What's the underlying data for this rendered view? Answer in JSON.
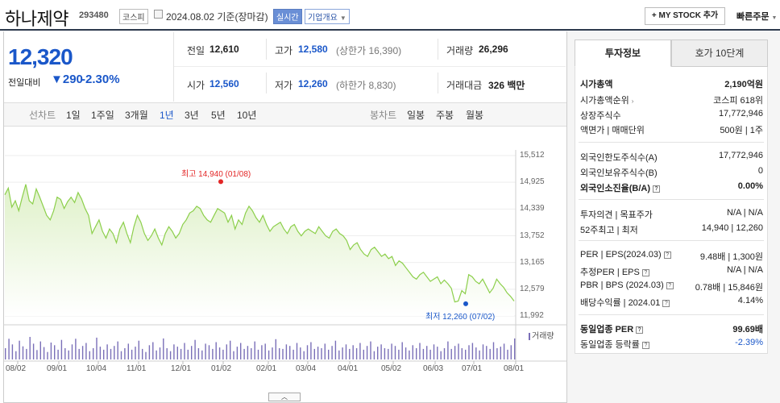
{
  "header": {
    "name": "하나제약",
    "code": "293480",
    "market": "코스피",
    "date_text": "2024.08.02 기준(장마감)",
    "realtime_tag": "실시간",
    "overview_tag": "기업개요",
    "mystock_label": "+ MY STOCK 추가",
    "quick_order": "빠른주문"
  },
  "quote": {
    "price": "12,320",
    "diff_label": "전일대비",
    "diff_arrow": "▼",
    "diff_value": "290",
    "diff_pct": "-2.30%",
    "prev_label": "전일",
    "prev_value": "12,610",
    "high_label": "고가",
    "high_value": "12,580",
    "upper_limit": "(상한가 16,390)",
    "volume_label": "거래량",
    "volume_value": "26,296",
    "open_label": "시가",
    "open_value": "12,560",
    "low_label": "저가",
    "low_value": "12,260",
    "lower_limit": "(하한가 8,830)",
    "amount_label": "거래대금",
    "amount_value": "326 백만"
  },
  "periods": {
    "line_label": "선차트",
    "line_items": [
      "1일",
      "1주일",
      "3개월",
      "1년",
      "3년",
      "5년",
      "10년"
    ],
    "selected": "1년",
    "candle_label": "봉차트",
    "candle_items": [
      "일봉",
      "주봉",
      "월봉"
    ]
  },
  "chart_data": {
    "type": "area",
    "title": "",
    "y_ticks": [
      "15,512",
      "14,925",
      "14,339",
      "13,752",
      "13,165",
      "12,579",
      "11,992"
    ],
    "ylim": [
      11992,
      15512
    ],
    "x_ticks": [
      "08/02",
      "09/01",
      "10/04",
      "11/01",
      "12/01",
      "01/02",
      "02/01",
      "03/04",
      "04/01",
      "05/02",
      "06/03",
      "07/01",
      "08/01"
    ],
    "high_label": "최고 14,940 (01/08)",
    "low_label": "최저 12,260 (07/02)",
    "high": 14940,
    "low": 12260,
    "volume_label": "거래량",
    "series": [
      {
        "values": [
          14650,
          14800,
          14380,
          14520,
          14300,
          14600,
          14880,
          14520,
          14450,
          14780,
          14600,
          14400,
          14200,
          14100,
          14300,
          14600,
          14550,
          14350,
          14500,
          14600,
          14480,
          14700,
          14560,
          14350,
          14200,
          13800,
          13950,
          14100,
          13850,
          13700,
          13900,
          13800,
          13600,
          13900,
          14050,
          13800,
          13600,
          13950,
          14200,
          14050,
          13800,
          13650,
          13750,
          13900,
          13700,
          13550,
          13800,
          13950,
          13850,
          13700,
          13800,
          14000,
          14100,
          14250,
          14300,
          14400,
          14350,
          14200,
          14100,
          14050,
          14200,
          14350,
          14300,
          14250,
          14050,
          14200,
          13900,
          14100,
          14000,
          14250,
          14400,
          14300,
          14150,
          14050,
          14200,
          14000,
          13850,
          13950,
          14000,
          14050,
          13900,
          13800,
          13950,
          14000,
          13850,
          13750,
          13850,
          13900,
          13850,
          13800,
          13950,
          13850,
          13750,
          13700,
          13850,
          13900,
          13800,
          13750,
          13650,
          13450,
          13550,
          13600,
          13450,
          13350,
          13300,
          13450,
          13500,
          13400,
          13300,
          13350,
          13250,
          13300,
          13100,
          13200,
          13150,
          13050,
          12950,
          12850,
          12800,
          12900,
          12950,
          12850,
          12750,
          12800,
          12850,
          12700,
          12780,
          12700,
          12600,
          12300,
          12320,
          12550,
          12480,
          12900,
          12850,
          12750,
          12700,
          12800,
          12650,
          12500,
          12600,
          12800,
          12700,
          12620,
          12500,
          12420,
          12320
        ]
      }
    ],
    "volume": [
      30,
      55,
      40,
      22,
      50,
      35,
      28,
      60,
      42,
      25,
      48,
      33,
      20,
      45,
      38,
      26,
      52,
      30,
      24,
      40,
      55,
      28,
      36,
      44,
      22,
      30,
      58,
      34,
      26,
      40,
      28,
      36,
      48,
      22,
      30,
      42,
      26,
      34,
      50,
      28,
      20,
      38,
      46,
      24,
      32,
      56,
      30,
      22,
      40,
      34,
      28,
      44,
      26,
      36,
      52,
      30,
      24,
      42,
      38,
      28,
      46,
      32,
      26,
      40,
      50,
      22,
      34,
      44,
      28,
      36,
      30,
      48,
      26,
      38,
      42,
      24,
      32,
      54,
      30,
      28,
      40,
      36,
      26,
      44,
      32,
      22,
      38,
      46,
      28,
      34,
      30,
      42,
      26,
      36,
      50,
      24,
      32,
      40,
      28,
      38,
      30,
      44,
      26,
      36,
      48,
      22,
      34,
      40,
      30,
      28,
      42,
      36,
      26,
      46,
      32,
      24,
      38,
      30,
      44,
      28,
      36,
      26,
      40,
      34,
      22,
      30,
      48,
      28,
      36,
      42,
      30,
      26,
      38,
      44,
      32,
      24,
      40,
      36,
      28,
      46,
      30,
      34,
      42,
      26,
      38,
      56
    ]
  },
  "right": {
    "tab_active": "투자정보",
    "tab_other": "호가 10단계",
    "rows1": [
      {
        "label": "시가총액",
        "value": "2,190억원",
        "bold": true
      },
      {
        "label": "시가총액순위",
        "value": "코스피 618위",
        "caret": true
      },
      {
        "label": "상장주식수",
        "value": "17,772,946"
      },
      {
        "label": "액면가 | 매매단위",
        "value": "500원 | 1주"
      }
    ],
    "rows2": [
      {
        "label": "외국인한도주식수(A)",
        "value": "17,772,946"
      },
      {
        "label": "외국인보유주식수(B)",
        "value": "0"
      },
      {
        "label": "외국인소진율(B/A)",
        "value": "0.00%",
        "bold": true
      }
    ],
    "rows3": [
      {
        "label": "투자의견 | 목표주가",
        "value": "N/A | N/A"
      },
      {
        "label": "52주최고 | 최저",
        "value": "14,940 | 12,260"
      }
    ],
    "rows4": [
      {
        "label": "PER | EPS(2024.03)",
        "value": "9.48배 | 1,300원"
      },
      {
        "label": "추정PER | EPS",
        "value": "N/A | N/A"
      },
      {
        "label": "PBR | BPS (2024.03)",
        "value": "0.78배 | 15,846원"
      },
      {
        "label": "배당수익률 | 2024.01",
        "value": "4.14%"
      }
    ],
    "rows5": [
      {
        "label": "동일업종 PER",
        "value": "99.69배",
        "bold": true
      },
      {
        "label": "동일업종 등락률",
        "value": "-2.39%",
        "blue": true
      }
    ]
  },
  "colors": {
    "accent": "#1a57c9",
    "down": "#1a57c9",
    "high": "#e32626",
    "line": "#8ccf4b",
    "fill": "#dff1c9"
  }
}
